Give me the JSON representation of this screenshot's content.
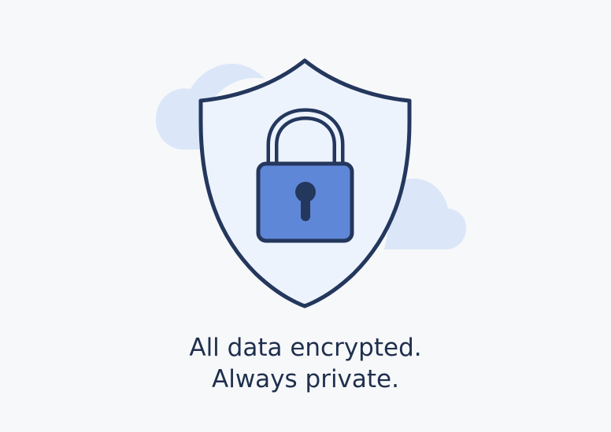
{
  "colors": {
    "background": "#f7f8fa",
    "cloud": "#dbe7f8",
    "shield_fill": "#edf3fd",
    "outline": "#24375d",
    "lock_body": "#5f87d8",
    "text": "#1f2f4d"
  },
  "illustration": {
    "icons": [
      "cloud-icon",
      "shield-icon",
      "padlock-icon",
      "keyhole-icon"
    ]
  },
  "caption": {
    "line1": "All data encrypted.",
    "line2": "Always private."
  }
}
